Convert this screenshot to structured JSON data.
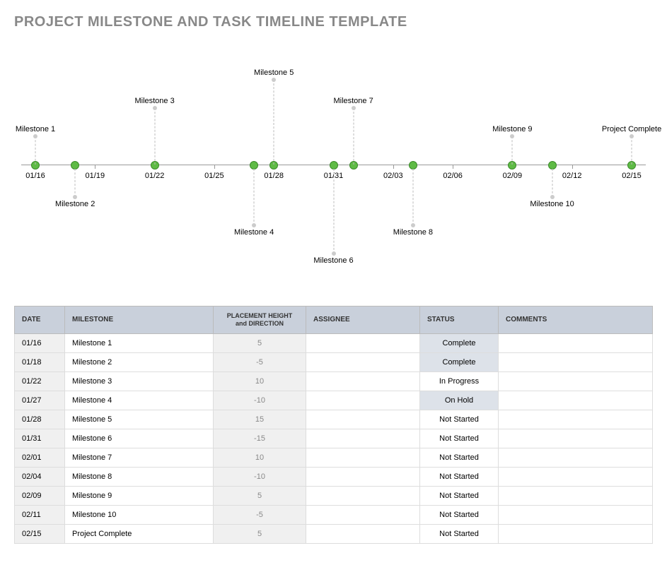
{
  "title": "PROJECT MILESTONE AND TASK TIMELINE TEMPLATE",
  "chart_data": {
    "type": "timeline",
    "axis_ticks": [
      "01/16",
      "01/19",
      "01/22",
      "01/25",
      "01/28",
      "01/31",
      "02/03",
      "02/06",
      "02/09",
      "02/12",
      "02/15"
    ],
    "axis_range": [
      "01/16",
      "02/15"
    ],
    "milestones": [
      {
        "date": "01/16",
        "label": "Milestone 1",
        "height": 5
      },
      {
        "date": "01/18",
        "label": "Milestone 2",
        "height": -5
      },
      {
        "date": "01/22",
        "label": "Milestone 3",
        "height": 10
      },
      {
        "date": "01/27",
        "label": "Milestone 4",
        "height": -10
      },
      {
        "date": "01/28",
        "label": "Milestone 5",
        "height": 15
      },
      {
        "date": "01/31",
        "label": "Milestone 6",
        "height": -15
      },
      {
        "date": "02/01",
        "label": "Milestone 7",
        "height": 10
      },
      {
        "date": "02/04",
        "label": "Milestone 8",
        "height": -10
      },
      {
        "date": "02/09",
        "label": "Milestone 9",
        "height": 5
      },
      {
        "date": "02/11",
        "label": "Milestone 10",
        "height": -5
      },
      {
        "date": "02/15",
        "label": "Project Complete",
        "height": 5
      }
    ]
  },
  "table": {
    "headers": {
      "date": "DATE",
      "milestone": "MILESTONE",
      "placement": "PLACEMENT HEIGHT and DIRECTION",
      "assignee": "ASSIGNEE",
      "status": "STATUS",
      "comments": "COMMENTS"
    },
    "rows": [
      {
        "date": "01/16",
        "milestone": "Milestone 1",
        "placement": "5",
        "assignee": "",
        "status": "Complete",
        "status_shaded": true,
        "comments": ""
      },
      {
        "date": "01/18",
        "milestone": "Milestone 2",
        "placement": "-5",
        "assignee": "",
        "status": "Complete",
        "status_shaded": true,
        "comments": ""
      },
      {
        "date": "01/22",
        "milestone": "Milestone 3",
        "placement": "10",
        "assignee": "",
        "status": "In Progress",
        "status_shaded": false,
        "comments": ""
      },
      {
        "date": "01/27",
        "milestone": "Milestone 4",
        "placement": "-10",
        "assignee": "",
        "status": "On Hold",
        "status_shaded": true,
        "comments": ""
      },
      {
        "date": "01/28",
        "milestone": "Milestone 5",
        "placement": "15",
        "assignee": "",
        "status": "Not Started",
        "status_shaded": false,
        "comments": ""
      },
      {
        "date": "01/31",
        "milestone": "Milestone 6",
        "placement": "-15",
        "assignee": "",
        "status": "Not Started",
        "status_shaded": false,
        "comments": ""
      },
      {
        "date": "02/01",
        "milestone": "Milestone 7",
        "placement": "10",
        "assignee": "",
        "status": "Not Started",
        "status_shaded": false,
        "comments": ""
      },
      {
        "date": "02/04",
        "milestone": "Milestone 8",
        "placement": "-10",
        "assignee": "",
        "status": "Not Started",
        "status_shaded": false,
        "comments": ""
      },
      {
        "date": "02/09",
        "milestone": "Milestone 9",
        "placement": "5",
        "assignee": "",
        "status": "Not Started",
        "status_shaded": false,
        "comments": ""
      },
      {
        "date": "02/11",
        "milestone": "Milestone 10",
        "placement": "-5",
        "assignee": "",
        "status": "Not Started",
        "status_shaded": false,
        "comments": ""
      },
      {
        "date": "02/15",
        "milestone": "Project Complete",
        "placement": "5",
        "assignee": "",
        "status": "Not Started",
        "status_shaded": false,
        "comments": ""
      }
    ]
  }
}
